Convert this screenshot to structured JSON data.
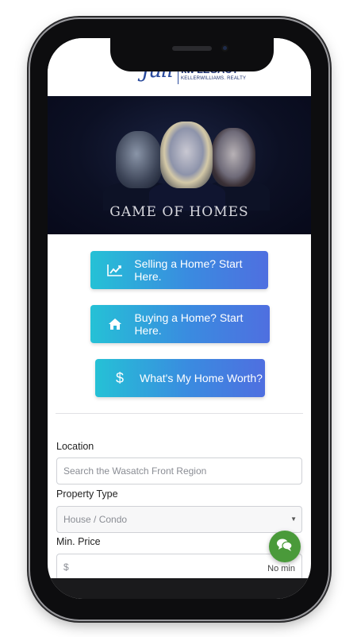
{
  "header": {
    "logo_script": "Juli",
    "logo_brand": "kw LEGACY",
    "logo_brand_sub": "KELLERWILLIAMS. REALTY"
  },
  "banner": {
    "title": "GAME OF HOMES"
  },
  "cta": {
    "sell_label": "Selling a Home? Start Here.",
    "sell_icon": "chart-line-icon",
    "buy_label": "Buying a Home? Start Here.",
    "buy_icon": "home-icon",
    "worth_label": "What's My Home Worth?",
    "worth_icon": "dollar-icon"
  },
  "form": {
    "location_label": "Location",
    "location_placeholder": "Search the Wasatch Front Region",
    "property_type_label": "Property Type",
    "property_type_value": "House / Condo",
    "min_price_label": "Min. Price",
    "min_price_prefix": "$",
    "min_price_value": "No min"
  },
  "chat": {
    "icon": "chat-bubbles-icon"
  },
  "colors": {
    "cta_gradient_start": "#25c1d6",
    "cta_gradient_end": "#4f6fe0",
    "chat_button": "#4a9a3a",
    "logo_blue": "#1b2f6e"
  }
}
